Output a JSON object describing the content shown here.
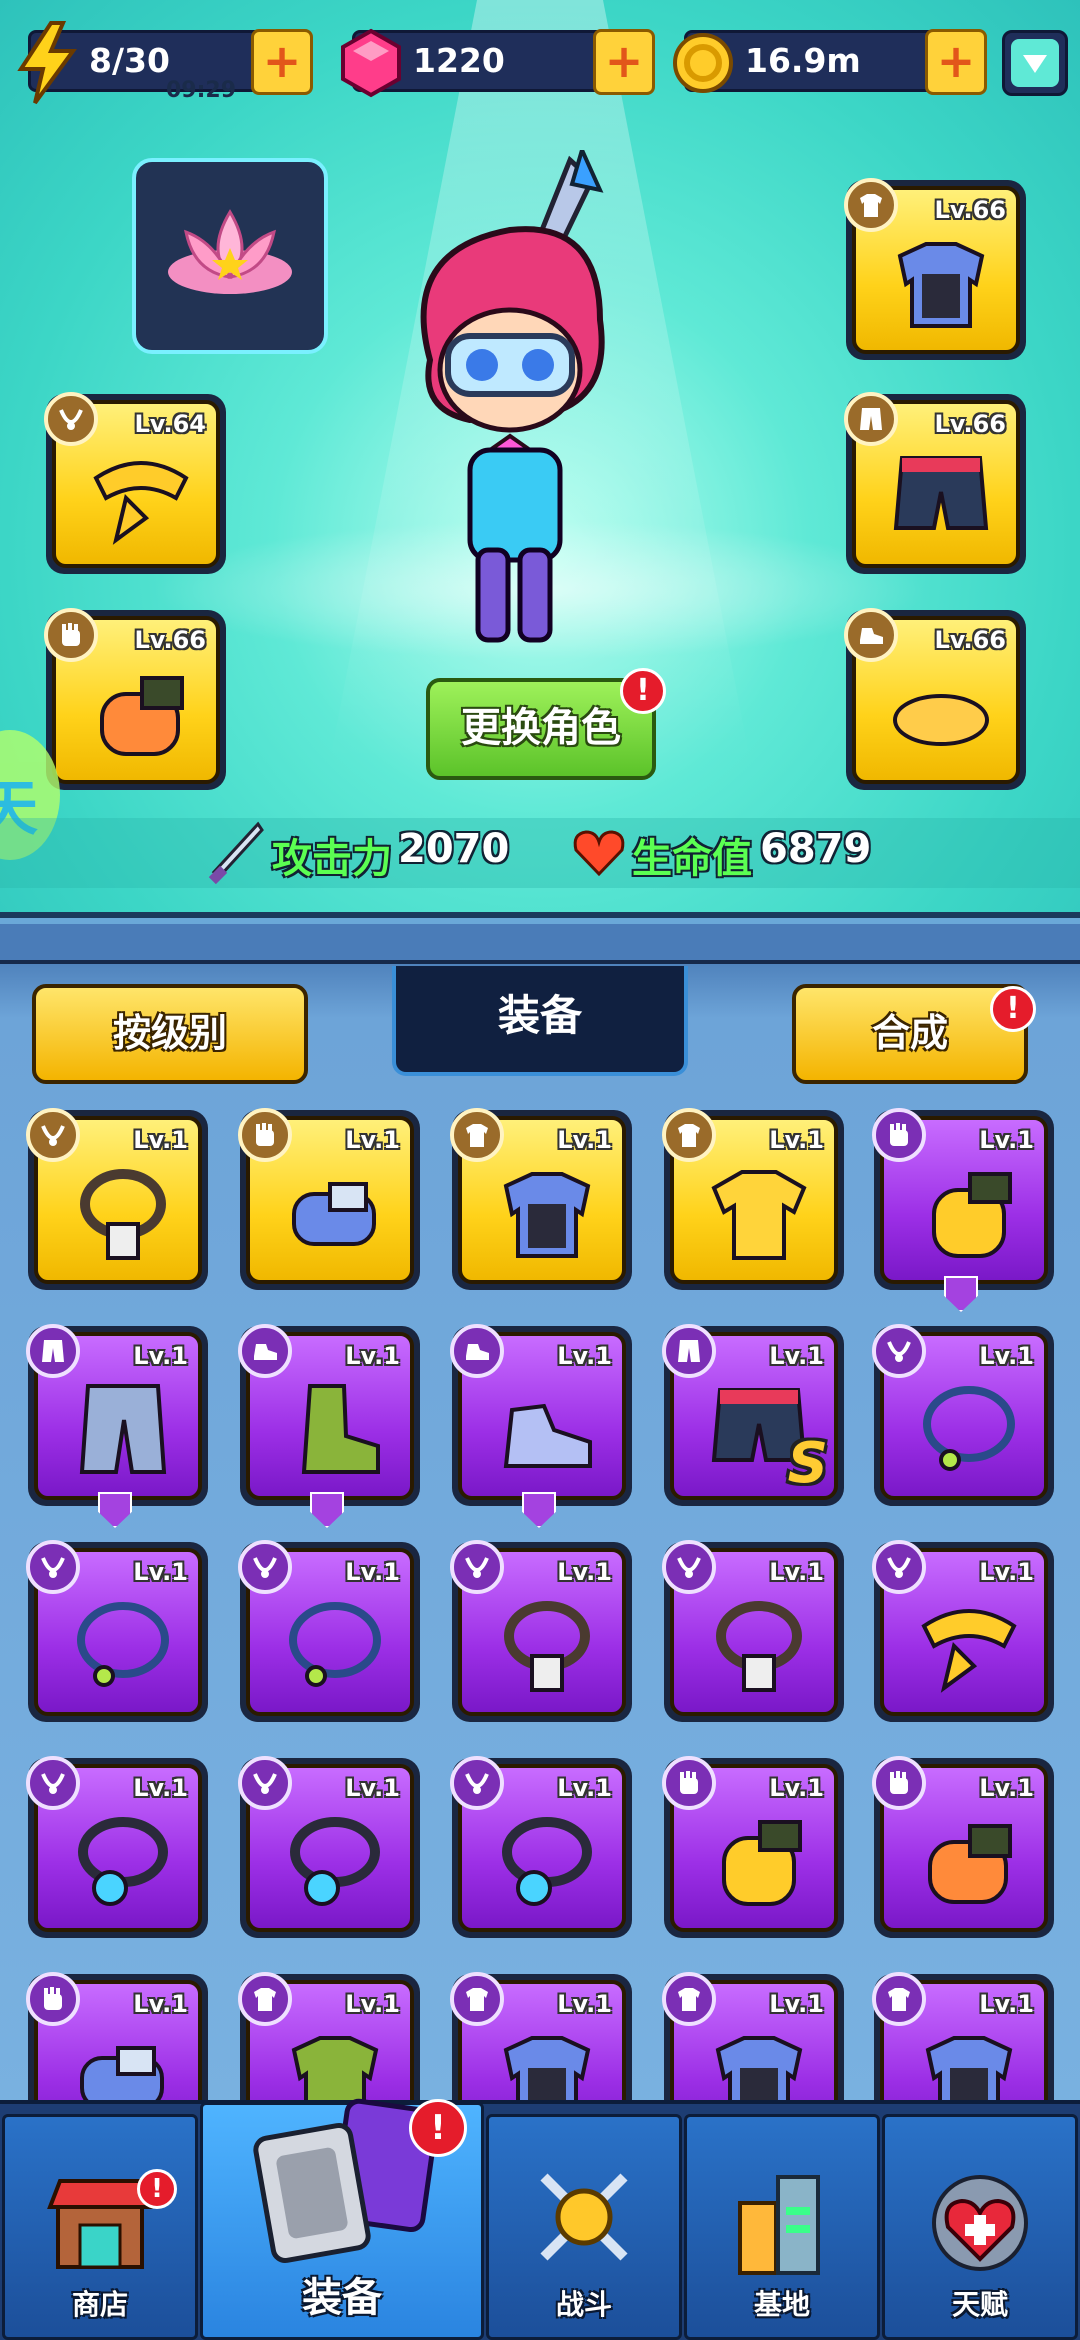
{
  "resources": {
    "energy": {
      "value": "8/30",
      "timer": "09:29"
    },
    "gems": {
      "value": "1220"
    },
    "gold": {
      "value": "16.9m"
    }
  },
  "hero": {
    "equipped_left": [
      {
        "level": "Lv.64",
        "type": "necklace",
        "item": "scarf"
      },
      {
        "level": "Lv.66",
        "type": "gloves",
        "item": "glove"
      }
    ],
    "equipped_right": [
      {
        "level": "Lv.66",
        "type": "armor",
        "item": "chest-armor"
      },
      {
        "level": "Lv.66",
        "type": "pants",
        "item": "shorts"
      },
      {
        "level": "Lv.66",
        "type": "shoes",
        "item": "sandals"
      }
    ],
    "change_button": "更换角色",
    "change_badge": "!",
    "side_badge": "天",
    "stats": {
      "attack_label": "攻击力",
      "attack_value": "2070",
      "hp_label": "生命值",
      "hp_value": "6879"
    }
  },
  "inventory": {
    "sort_button": "按级别",
    "tab_title": "装备",
    "merge_button": "合成",
    "merge_badge": "!",
    "items": [
      {
        "level": "Lv.1",
        "rarity": "yellow",
        "type": "necklace",
        "art": "tag-necklace"
      },
      {
        "level": "Lv.1",
        "rarity": "yellow",
        "type": "gloves",
        "art": "blue-glove"
      },
      {
        "level": "Lv.1",
        "rarity": "yellow",
        "type": "armor",
        "art": "chest-armor"
      },
      {
        "level": "Lv.1",
        "rarity": "yellow",
        "type": "armor",
        "art": "shirt"
      },
      {
        "level": "Lv.1",
        "rarity": "purple",
        "type": "gloves",
        "art": "yellow-glove",
        "down": true
      },
      {
        "level": "Lv.1",
        "rarity": "purple",
        "type": "pants",
        "art": "armor-pants",
        "down": true
      },
      {
        "level": "Lv.1",
        "rarity": "purple",
        "type": "shoes",
        "art": "boot",
        "down": true
      },
      {
        "level": "Lv.1",
        "rarity": "purple",
        "type": "shoes",
        "art": "sneaker",
        "down": true
      },
      {
        "level": "Lv.1",
        "rarity": "purple",
        "type": "pants",
        "art": "shorts",
        "mark": "S"
      },
      {
        "level": "Lv.1",
        "rarity": "purple",
        "type": "necklace",
        "art": "ring-necklace"
      },
      {
        "level": "Lv.1",
        "rarity": "purple",
        "type": "necklace",
        "art": "ring-necklace"
      },
      {
        "level": "Lv.1",
        "rarity": "purple",
        "type": "necklace",
        "art": "ring-necklace"
      },
      {
        "level": "Lv.1",
        "rarity": "purple",
        "type": "necklace",
        "art": "tag-necklace"
      },
      {
        "level": "Lv.1",
        "rarity": "purple",
        "type": "necklace",
        "art": "tag-necklace"
      },
      {
        "level": "Lv.1",
        "rarity": "purple",
        "type": "necklace",
        "art": "scarf"
      },
      {
        "level": "Lv.1",
        "rarity": "purple",
        "type": "necklace",
        "art": "gem-necklace"
      },
      {
        "level": "Lv.1",
        "rarity": "purple",
        "type": "necklace",
        "art": "gem-necklace"
      },
      {
        "level": "Lv.1",
        "rarity": "purple",
        "type": "necklace",
        "art": "gem-necklace"
      },
      {
        "level": "Lv.1",
        "rarity": "purple",
        "type": "gloves",
        "art": "yellow-glove"
      },
      {
        "level": "Lv.1",
        "rarity": "purple",
        "type": "gloves",
        "art": "glove"
      },
      {
        "level": "Lv.1",
        "rarity": "purple",
        "type": "gloves",
        "art": "blue-glove"
      },
      {
        "level": "Lv.1",
        "rarity": "purple",
        "type": "armor",
        "art": "green-armor"
      },
      {
        "level": "Lv.1",
        "rarity": "purple",
        "type": "armor",
        "art": "chest-armor"
      },
      {
        "level": "Lv.1",
        "rarity": "purple",
        "type": "armor",
        "art": "chest-armor"
      },
      {
        "level": "Lv.1",
        "rarity": "purple",
        "type": "armor",
        "art": "chest-armor"
      }
    ]
  },
  "nav": {
    "shop": "商店",
    "shop_badge": "!",
    "equip": "装备",
    "equip_badge": "!",
    "battle": "战斗",
    "base": "基地",
    "talent": "天赋"
  },
  "colors": {
    "yellow_slot": "#ffd21a",
    "purple_slot": "#9c2fe6",
    "stat_green": "#5bff52",
    "badge_red": "#e51c2b"
  }
}
